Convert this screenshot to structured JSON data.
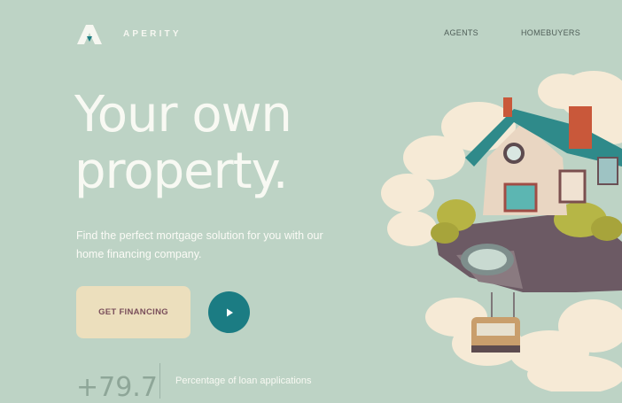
{
  "brand": {
    "name": "APERITY"
  },
  "nav": {
    "items": [
      "AGENTS",
      "HOMEBUYERS"
    ]
  },
  "hero": {
    "title_line1": "Your own",
    "title_line2": "property.",
    "subtitle": "Find the perfect mortgage solution for you with our home financing company.",
    "cta_label": "GET FINANCING"
  },
  "stat": {
    "value": "+79.7",
    "label": "Percentage of loan applications"
  },
  "colors": {
    "background": "#bdd3c5",
    "accent": "#1b7c83",
    "cta": "#ecdfbd"
  },
  "icons": {
    "play": "play-icon",
    "logo": "aperity-logo-icon"
  }
}
